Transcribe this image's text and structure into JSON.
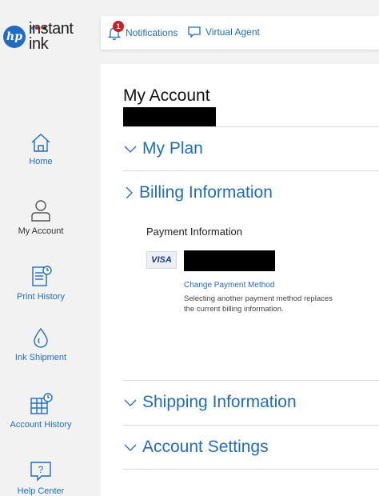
{
  "brand": {
    "line1": "instant",
    "line2": "ink",
    "hp": "hp",
    "ink_colors": [
      "#00a7e1",
      "#e6007e",
      "#ffd200",
      "#222222"
    ]
  },
  "sidebar": {
    "items": [
      {
        "label": "Home",
        "icon": "home-icon"
      },
      {
        "label": "My Account",
        "icon": "user-icon"
      },
      {
        "label": "Print History",
        "icon": "print-history-icon"
      },
      {
        "label": "Ink Shipment",
        "icon": "ink-drop-icon"
      },
      {
        "label": "Account History",
        "icon": "account-history-icon"
      },
      {
        "label": "Help Center",
        "icon": "help-icon"
      }
    ]
  },
  "topbar": {
    "notifications": {
      "label": "Notifications",
      "count": "1"
    },
    "virtual_agent": {
      "label": "Virtual Agent"
    }
  },
  "main": {
    "title": "My Account",
    "sections": {
      "plan": "My Plan",
      "billing": "Billing Information",
      "shipping": "Shipping Information",
      "settings": "Account Settings"
    },
    "billing": {
      "payment_title": "Payment Information",
      "card_brand": "VISA",
      "change_link": "Change Payment Method",
      "change_note": "Selecting another payment method replaces the current billing information."
    }
  },
  "colors": {
    "accent": "#1f6dc2",
    "badge": "#cc1f1f"
  }
}
